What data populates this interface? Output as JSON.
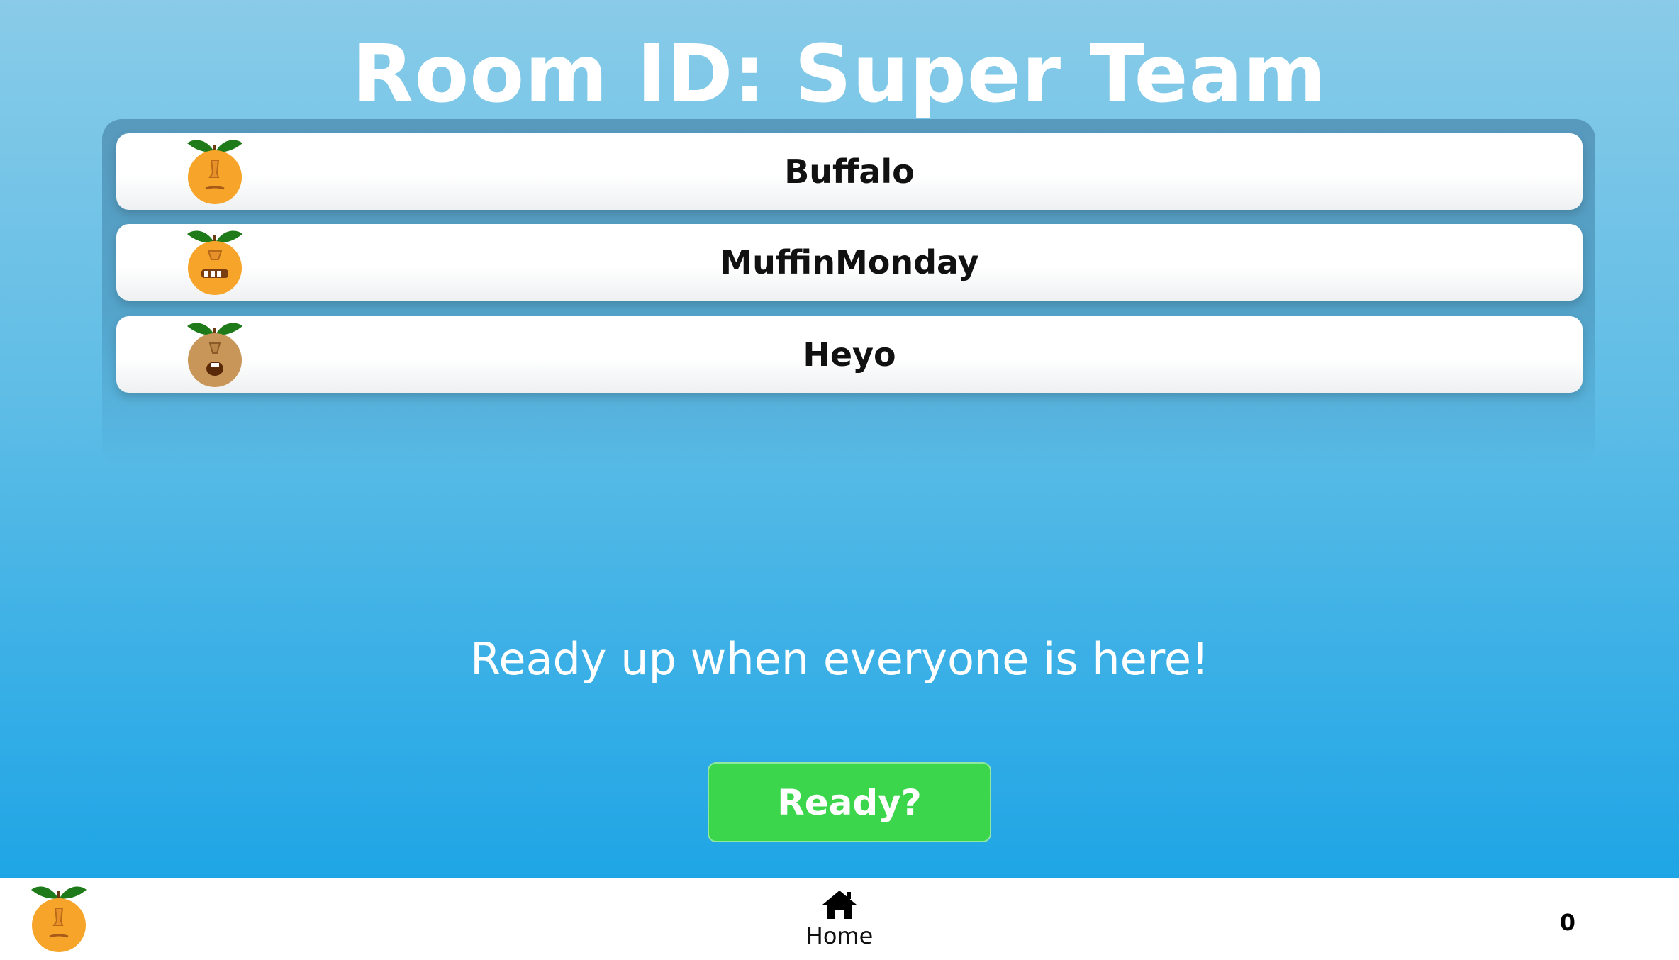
{
  "room": {
    "title": "Room ID: Super Team"
  },
  "players": [
    {
      "name": "Buffalo",
      "avatar": "orange-frown-face-icon"
    },
    {
      "name": "MuffinMonday",
      "avatar": "orange-grin-face-icon"
    },
    {
      "name": "Heyo",
      "avatar": "tan-surprised-face-icon"
    }
  ],
  "prompt": "Ready up when everyone is here!",
  "ready_button": {
    "label": "Ready?",
    "color": "#3bd64c"
  },
  "bottom_bar": {
    "avatar": "orange-frown-face-icon",
    "home_icon": "home-icon",
    "home_label": "Home",
    "score": "0"
  },
  "colors": {
    "background_top": "#89cbe8",
    "background_bottom": "#1fa5e5",
    "orange_fruit": "#f7a52a",
    "tan_fruit": "#c89658",
    "leaf": "#1f7a1a"
  }
}
